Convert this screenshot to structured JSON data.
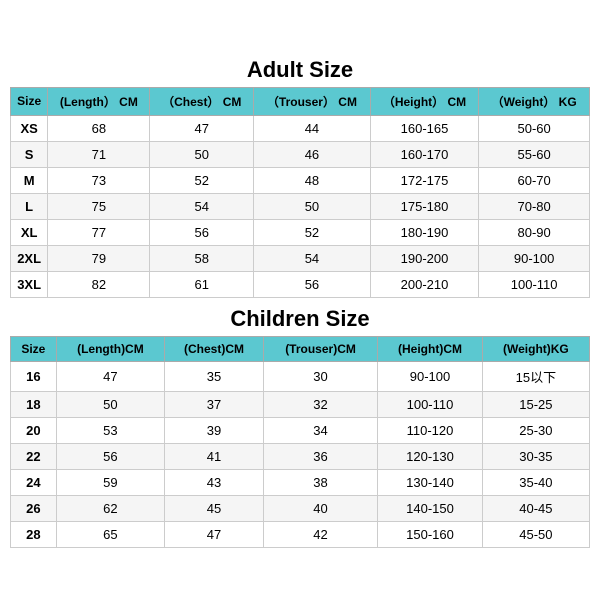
{
  "adult": {
    "title": "Adult Size",
    "headers": [
      "Size",
      "(Length） CM",
      "（Chest） CM",
      "（Trouser） CM",
      "（Height） CM",
      "（Weight） KG"
    ],
    "rows": [
      [
        "XS",
        "68",
        "47",
        "44",
        "160-165",
        "50-60"
      ],
      [
        "S",
        "71",
        "50",
        "46",
        "160-170",
        "55-60"
      ],
      [
        "M",
        "73",
        "52",
        "48",
        "172-175",
        "60-70"
      ],
      [
        "L",
        "75",
        "54",
        "50",
        "175-180",
        "70-80"
      ],
      [
        "XL",
        "77",
        "56",
        "52",
        "180-190",
        "80-90"
      ],
      [
        "2XL",
        "79",
        "58",
        "54",
        "190-200",
        "90-100"
      ],
      [
        "3XL",
        "82",
        "61",
        "56",
        "200-210",
        "100-110"
      ]
    ]
  },
  "children": {
    "title": "Children Size",
    "headers": [
      "Size",
      "(Length)CM",
      "(Chest)CM",
      "(Trouser)CM",
      "(Height)CM",
      "(Weight)KG"
    ],
    "rows": [
      [
        "16",
        "47",
        "35",
        "30",
        "90-100",
        "15以下"
      ],
      [
        "18",
        "50",
        "37",
        "32",
        "100-110",
        "15-25"
      ],
      [
        "20",
        "53",
        "39",
        "34",
        "110-120",
        "25-30"
      ],
      [
        "22",
        "56",
        "41",
        "36",
        "120-130",
        "30-35"
      ],
      [
        "24",
        "59",
        "43",
        "38",
        "130-140",
        "35-40"
      ],
      [
        "26",
        "62",
        "45",
        "40",
        "140-150",
        "40-45"
      ],
      [
        "28",
        "65",
        "47",
        "42",
        "150-160",
        "45-50"
      ]
    ]
  }
}
